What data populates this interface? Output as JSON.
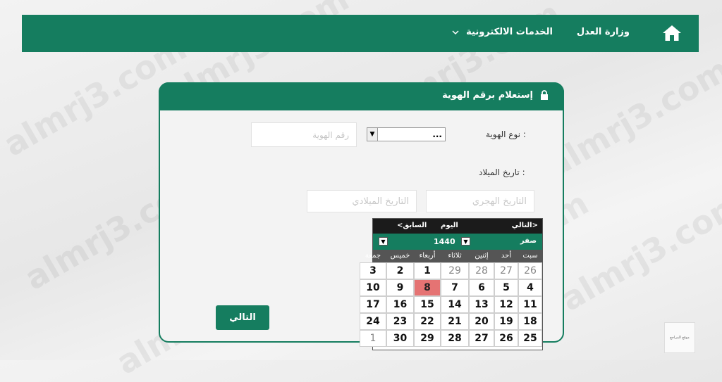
{
  "nav": {
    "ministry": "وزارة العدل",
    "services": "الخدمات الالكترونية"
  },
  "card": {
    "title": "إستعلام برقم الهوية"
  },
  "form": {
    "id_type_label": "نوع الهوية :",
    "id_type_value": "...",
    "id_number_placeholder": "رقم الهوية",
    "birth_date_label": "تاريخ الميلاد :",
    "hijri_placeholder": "التاريخ الهجري",
    "gregorian_placeholder": "التاريخ الميلادي",
    "next_button": "التالي"
  },
  "calendar": {
    "next": "التالي>",
    "today": "اليوم",
    "prev": "<السابق",
    "year": "1440",
    "month": "صفر",
    "weekdays": [
      "سبت",
      "أحد",
      "إثنين",
      "ثلاثاء",
      "أربعاء",
      "خميس",
      "جمعة"
    ],
    "weeks": [
      [
        "26",
        "27",
        "28",
        "29",
        "1",
        "2",
        "3"
      ],
      [
        "4",
        "5",
        "6",
        "7",
        "8",
        "9",
        "10"
      ],
      [
        "11",
        "12",
        "13",
        "14",
        "15",
        "16",
        "17"
      ],
      [
        "18",
        "19",
        "20",
        "21",
        "22",
        "23",
        "24"
      ],
      [
        "25",
        "26",
        "27",
        "28",
        "29",
        "30",
        "1"
      ]
    ],
    "today_day": "8"
  },
  "watermark": "almrj3.com",
  "thumbnail": "موقع المراجع",
  "colors": {
    "primary": "#157d5f",
    "today": "#e57373"
  }
}
